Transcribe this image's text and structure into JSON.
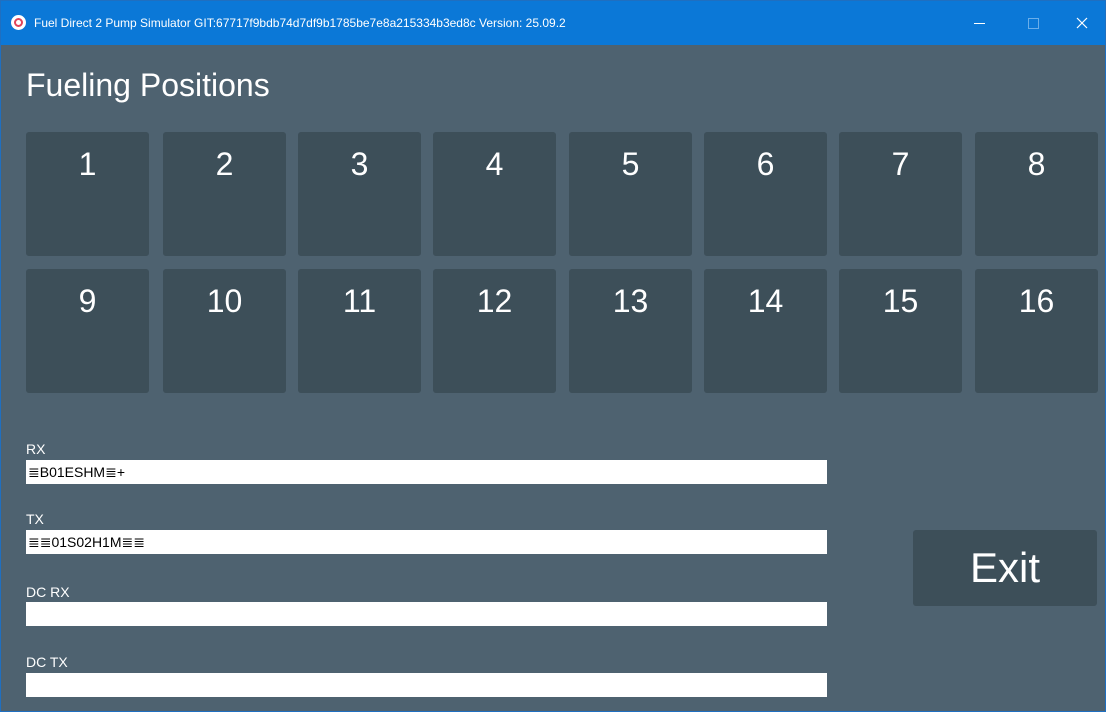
{
  "window": {
    "title": "Fuel Direct 2 Pump Simulator GIT:67717f9bdb74d7df9b1785be7e8a215334b3ed8c Version: 25.09.2",
    "icon": "app-logo-icon",
    "controls": {
      "minimize": "minimize-icon",
      "maximize": "maximize-icon",
      "close": "close-icon"
    }
  },
  "heading": "Fueling Positions",
  "fueling_positions": [
    "1",
    "2",
    "3",
    "4",
    "5",
    "6",
    "7",
    "8",
    "9",
    "10",
    "11",
    "12",
    "13",
    "14",
    "15",
    "16"
  ],
  "fields": {
    "rx": {
      "label": "RX",
      "value": "≣B01ESHM≣+"
    },
    "tx": {
      "label": "TX",
      "value": "≣≣01S02H1M≣≣"
    },
    "dc_rx": {
      "label": "DC RX",
      "value": ""
    },
    "dc_tx": {
      "label": "DC TX",
      "value": ""
    }
  },
  "exit_label": "Exit",
  "colors": {
    "titlebar": "#0b78d7",
    "background": "#4e6270",
    "tile": "#3d4f59",
    "text": "#ffffff"
  }
}
